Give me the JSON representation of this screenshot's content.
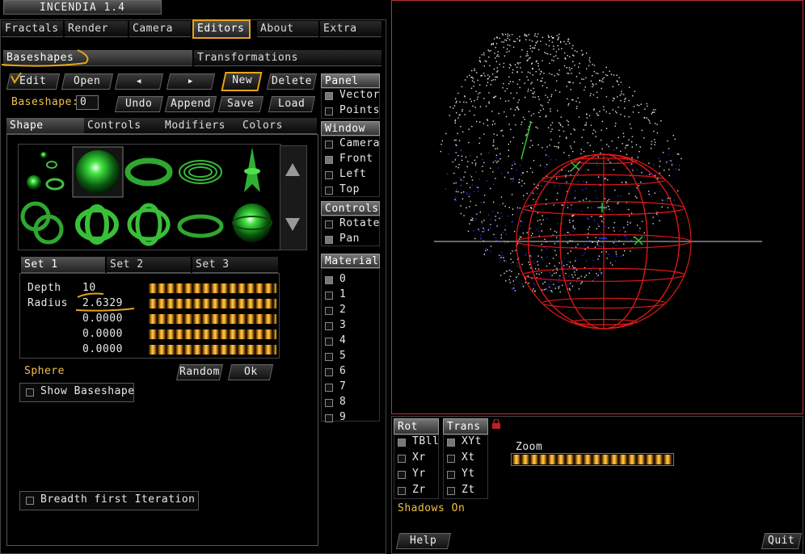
{
  "app": {
    "title": "INCENDIA 1.4"
  },
  "menu": [
    "Fractals",
    "Render",
    "Camera",
    "Editors",
    "About",
    "Extra"
  ],
  "subtabs": [
    "Baseshapes",
    "Transformations"
  ],
  "toolbar": {
    "edit": "Edit",
    "open": "Open",
    "prev": "◀",
    "next": "▶",
    "new": "New",
    "delete": "Delete",
    "baseshape_label": "Baseshape:",
    "baseshape_value": "0",
    "undo": "Undo",
    "append": "Append",
    "save": "Save",
    "load": "Load"
  },
  "shape_tabs": [
    "Shape",
    "Controls",
    "Modifiers",
    "Colors"
  ],
  "set_tabs": [
    "Set 1",
    "Set 2",
    "Set 3"
  ],
  "params": [
    {
      "label": "Depth",
      "value": "10"
    },
    {
      "label": "Radius",
      "value": "2.6329"
    },
    {
      "label": "",
      "value": "0.0000"
    },
    {
      "label": "",
      "value": "0.0000"
    },
    {
      "label": "",
      "value": "0.0000"
    }
  ],
  "shape_name": "Sphere",
  "random_label": "Random",
  "ok_label": "Ok",
  "show_baseshape": "Show Baseshape",
  "breadth_first": "Breadth first Iteration",
  "panel": {
    "header": "Panel",
    "items": [
      {
        "label": "Vector",
        "checked": true
      },
      {
        "label": "Points",
        "checked": false
      }
    ]
  },
  "window": {
    "header": "Window",
    "items": [
      {
        "label": "Camera",
        "checked": false
      },
      {
        "label": "Front",
        "checked": true
      },
      {
        "label": "Left",
        "checked": false
      },
      {
        "label": "Top",
        "checked": false
      }
    ]
  },
  "controls": {
    "header": "Controls",
    "items": [
      {
        "label": "Rotate",
        "checked": false
      },
      {
        "label": "Pan",
        "checked": true
      }
    ]
  },
  "material": {
    "header": "Material",
    "items": [
      "0",
      "1",
      "2",
      "3",
      "4",
      "5",
      "6",
      "7",
      "8",
      "9"
    ],
    "checked_index": 0
  },
  "rot": {
    "header": "Rot",
    "items": [
      {
        "label": "TBll",
        "checked": true
      },
      {
        "label": "Xr",
        "checked": false
      },
      {
        "label": "Yr",
        "checked": false
      },
      {
        "label": "Zr",
        "checked": false
      }
    ]
  },
  "trans": {
    "header": "Trans",
    "items": [
      {
        "label": "XYt",
        "checked": true
      },
      {
        "label": "Xt",
        "checked": false
      },
      {
        "label": "Yt",
        "checked": false
      },
      {
        "label": "Zt",
        "checked": false
      }
    ]
  },
  "zoom_label": "Zoom",
  "shadows_label": "Shadows On",
  "help_label": "Help",
  "quit_label": "Quit",
  "colors": {
    "accent": "#e6a519",
    "viewport_border": "#c0303a",
    "sphere": "#e01818",
    "points": "#e0e0e0",
    "blue_points": "#2030e0"
  }
}
